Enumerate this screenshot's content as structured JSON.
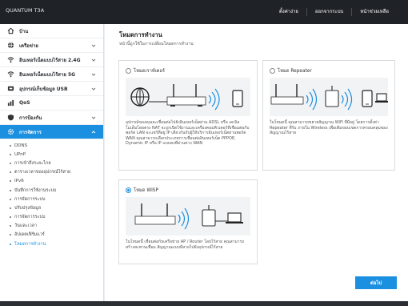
{
  "header": {
    "brand_line1": "",
    "model": "QUANTUM T3A",
    "nav": [
      "ตั้งค่าง่าย",
      "ออกจากระบบ",
      "หน้าช่วยเหลือ"
    ]
  },
  "sidebar": {
    "items": [
      {
        "label": "บ้าน",
        "icon": "home-icon"
      },
      {
        "label": "เครือข่าย",
        "icon": "globe-icon"
      },
      {
        "label": "อินเทอร์เน็ตแบบไร้สาย 2.4G",
        "icon": "wifi-icon"
      },
      {
        "label": "อินเทอร์เน็ตแบบไร้สาย 5G",
        "icon": "wifi-icon"
      },
      {
        "label": "อุปกรณ์เก็บข้อมูล USB",
        "icon": "usb-icon"
      },
      {
        "label": "QoS",
        "icon": "qos-icon"
      },
      {
        "label": "การป้องกัน",
        "icon": "shield-icon"
      },
      {
        "label": "การจัดการ",
        "icon": "gear-icon"
      }
    ],
    "submenu": [
      "DDNS",
      "UPnP",
      "การเข้าถึงระยะไกล",
      "ตารางเวลาของอุปกรณ์ไร้สาย",
      "IPv6",
      "บันทึกการใช้งานระบบ",
      "การจัดการระบบ",
      "ปรับปรุงข้อมูล",
      "การจัดการระบบ",
      "วันและเวลา",
      "อัปเดตเฟิร์มแวร์",
      "โหมดการทำงาน"
    ]
  },
  "main": {
    "title": "โหมดการทำงาน",
    "description": "หน้านี้ถูกใช้ในการเปลี่ยนโหมดการทำงาน",
    "modes": [
      {
        "label": "โหมดเราท์เตอร์",
        "checked": false,
        "description": "อุปกรณ์ของคุณจะเชื่อมต่อไปยังอินเทอร์เน็ตผ่าน ADSL หรือ เคเบิลโมเด็มโดยตรง NAT จะถูกเปิดใช้งานและเครื่องคอมพิวเตอร์ที่เชื่อมต่อกับพอร์ต LAN จะแชร์ที่อยู่ IP เดียวกันกับผู้ให้บริการอินเทอร์เน็ตผ่านพอร์ต WAN คุณสามารถเลือกประเภทการเชื่อมต่ออินเทอร์เน็ต PPPOE, Dynamic IP หรือ IP แบบคงที่ผ่านทาง WAN"
      },
      {
        "label": "โหมด Repeater",
        "checked": false,
        "description": "ในโหมดนี้ คุณสามารถขยายสัญญาณ WiFi ที่มีอยู่ โดยการตั้งค่า Repeater ที่รับ ภายใน Wireless เพื่อเพิ่มขอบเขตการครอบคลุมของสัญญาณไร้สาย"
      },
      {
        "label": "โหมด WISP",
        "checked": true,
        "description": "ในโหมดนี้ เชื่อมต่อกับเครือข่าย AP / Router โดยไร้สาย คุณสามารถสร้างสะพานเชื่อม สัญญาณแบบมีสายไปยังอุปกรณ์ไร้สาย"
      }
    ],
    "apply_label": "ต่อไป"
  },
  "colors": {
    "accent": "#1b8fe0",
    "header": "#1f2226"
  }
}
